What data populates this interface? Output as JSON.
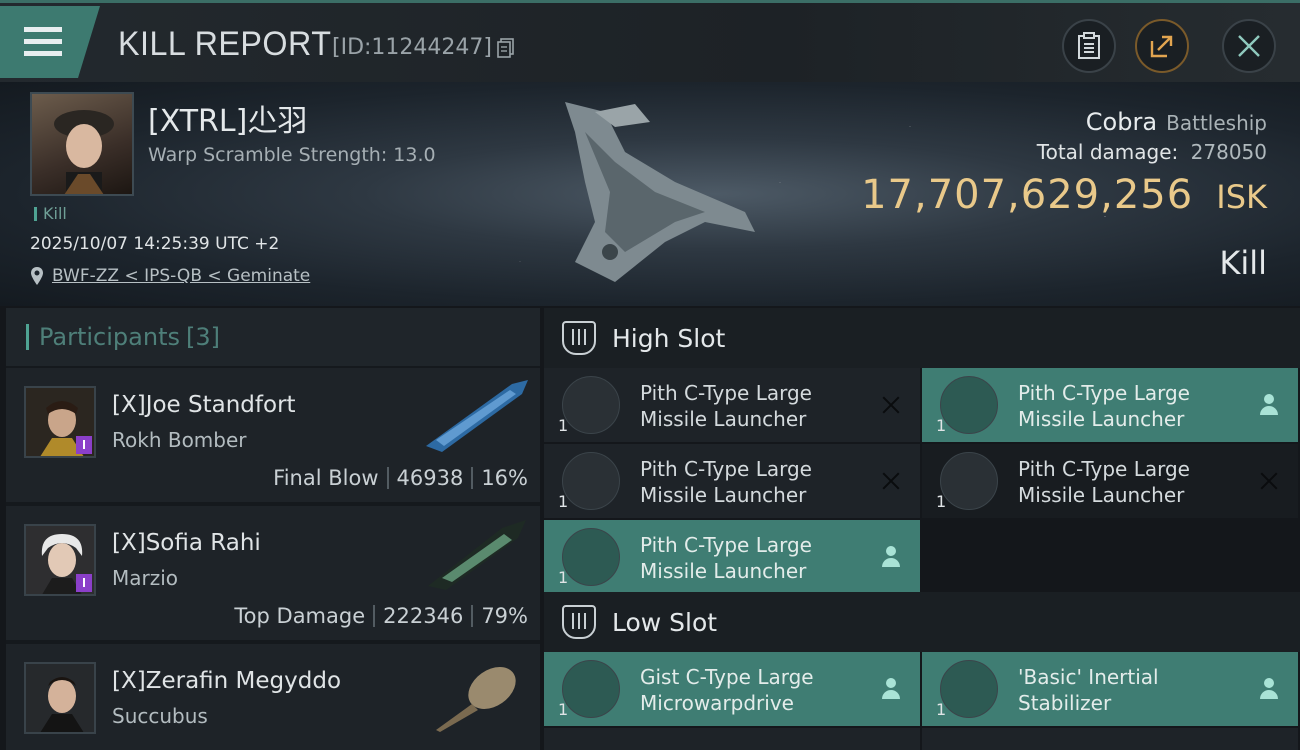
{
  "header": {
    "title": "KILL REPORT",
    "kill_id": "[ID:11244247]",
    "icons": [
      "menu-icon",
      "copy-icon",
      "clipboard-icon",
      "share-icon",
      "close-icon"
    ],
    "accent_color": "#3d7a70"
  },
  "victim": {
    "name": "[XTRL]尐羽",
    "warp_scramble": "Warp Scramble Strength: 13.0",
    "tag": "Kill",
    "datetime": "2025/10/07 14:25:39 UTC +2",
    "location": "BWF-ZZ < IPS-QB < Geminate",
    "ship_name": "Cobra",
    "ship_class": "Battleship",
    "total_damage_label": "Total damage:",
    "total_damage": "278050",
    "isk_value": "17,707,629,256",
    "isk_unit": "ISK",
    "status": "Kill",
    "isk_color": "#e9c98a"
  },
  "participants": {
    "title": "Participants",
    "count": "[3]",
    "rows": [
      {
        "name": "[X]Joe Standfort",
        "ship": "Rokh Bomber",
        "label": "Final Blow",
        "damage": "46938",
        "percent": "16%"
      },
      {
        "name": "[X]Sofia Rahi",
        "ship": "Marzio",
        "label": "Top Damage",
        "damage": "222346",
        "percent": "79%"
      },
      {
        "name": "[X]Zerafin Megyddo",
        "ship": "Succubus"
      }
    ]
  },
  "fittings": {
    "high_slot_title": "High Slot",
    "low_slot_title": "Low Slot",
    "high_slot": [
      {
        "line1": "Pith C-Type Large",
        "line2": "Missile Launcher",
        "qty": "1",
        "state": "destroyed"
      },
      {
        "line1": "Pith C-Type Large",
        "line2": "Missile Launcher",
        "qty": "1",
        "state": "dropped"
      },
      {
        "line1": "Pith C-Type Large",
        "line2": "Missile Launcher",
        "qty": "1",
        "state": "destroyed"
      },
      {
        "line1": "Pith C-Type Large",
        "line2": "Missile Launcher",
        "qty": "1",
        "state": "destroyed"
      },
      {
        "line1": "Pith C-Type Large",
        "line2": "Missile Launcher",
        "qty": "1",
        "state": "dropped"
      }
    ],
    "low_slot": [
      {
        "line1": "Gist C-Type Large",
        "line2": "Microwarpdrive",
        "qty": "1",
        "state": "dropped"
      },
      {
        "line1": "'Basic' Inertial",
        "line2": "Stabilizer",
        "qty": "1",
        "state": "dropped"
      }
    ],
    "dropped_color": "#3f7d73"
  }
}
